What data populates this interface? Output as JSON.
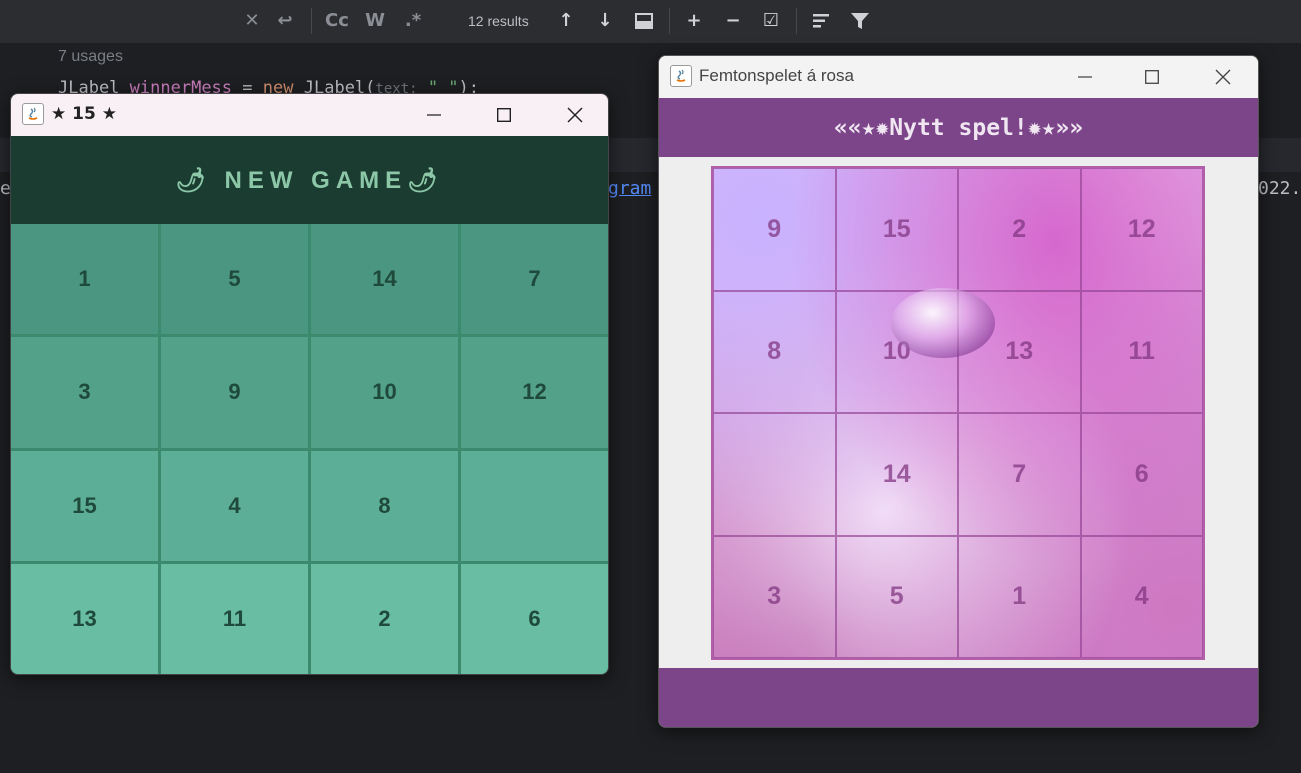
{
  "ide": {
    "toolbar": {
      "close_symbol": "✕",
      "replace_symbol": "↩",
      "match_case_label": "Cc",
      "whole_word_label": "W",
      "regex_label": ".*",
      "results_text": "12 results",
      "prev_symbol": "↑",
      "next_symbol": "↓",
      "add_selection_symbol": "+",
      "remove_selection_symbol": "−",
      "select_all_symbol": "☑",
      "filter_symbol": "▼"
    },
    "usages_text": "7 usages",
    "code_line": {
      "type": "JLabel",
      "field": "winnerMess",
      "eq": "=",
      "kw_new": "new",
      "ctor": "JLabel(",
      "hint": "text:",
      "str": "\" \"",
      "end": ");"
    },
    "fragment_left": "e",
    "fragment_link": "gram",
    "fragment_right": "022."
  },
  "window1": {
    "title": "★ 15 ★",
    "header_label": "🌶 NEW GAME🌶",
    "tiles": [
      "1",
      "5",
      "14",
      "7",
      "3",
      "9",
      "10",
      "12",
      "15",
      "4",
      "8",
      "",
      "13",
      "11",
      "2",
      "6"
    ],
    "colors": {
      "row1": "#4a9680",
      "row2": "#53a189",
      "row3": "#5dae96",
      "row4": "#69bda3"
    }
  },
  "window2": {
    "title": "Femtonspelet á rosa",
    "header_label": "««★✹Nytt spel!✹★»»",
    "tiles": [
      "9",
      "15",
      "2",
      "12",
      "8",
      "10",
      "13",
      "11",
      "",
      "14",
      "7",
      "6",
      "3",
      "5",
      "1",
      "4"
    ],
    "colors": {
      "bar": "#7c4489",
      "tile_text": "#8a3a88"
    }
  }
}
